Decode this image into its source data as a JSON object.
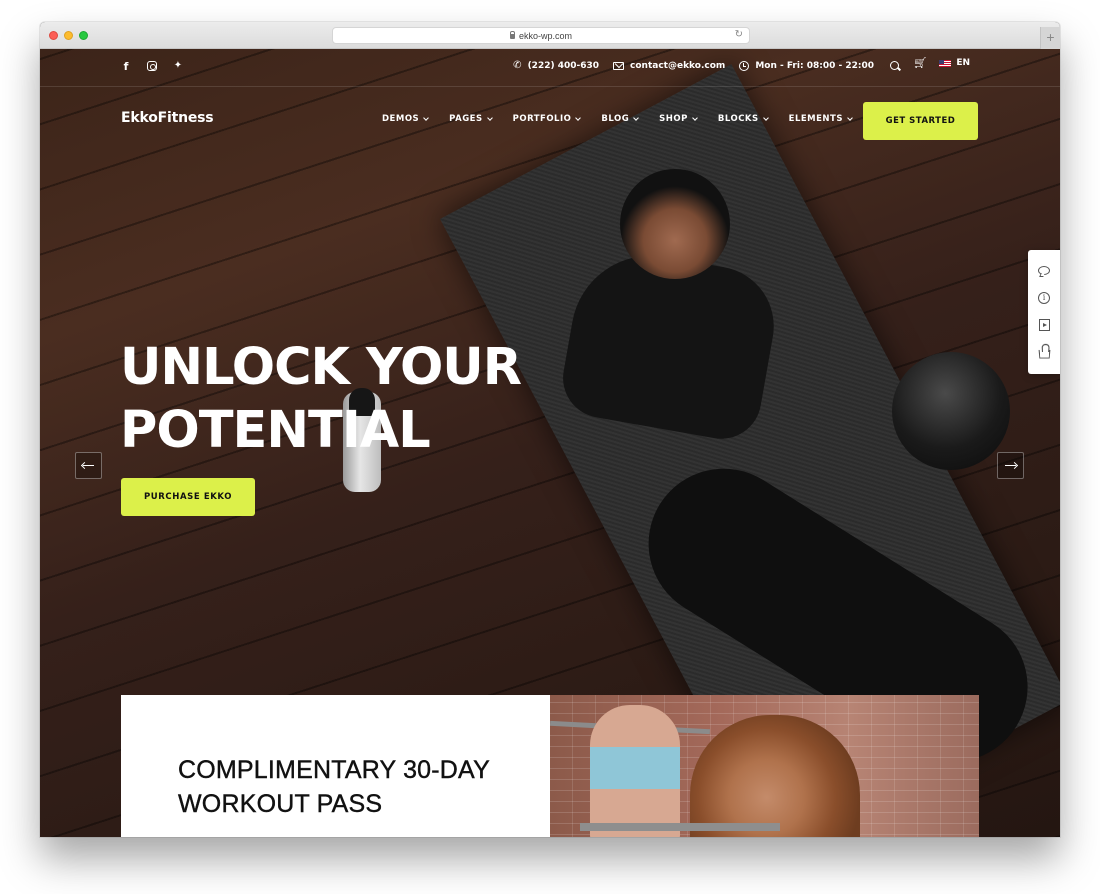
{
  "browser": {
    "url": "ekko-wp.com",
    "new_tab_symbol": "+",
    "reload_symbol": "↻"
  },
  "topbar": {
    "social": [
      {
        "name": "facebook",
        "glyph": "f"
      },
      {
        "name": "instagram",
        "glyph": ""
      },
      {
        "name": "twitter",
        "glyph": "🐦"
      }
    ],
    "phone": "(222) 400-630",
    "email": "contact@ekko.com",
    "hours": "Mon - Fri: 08:00 - 22:00",
    "phone_glyph": "✆",
    "cart_glyph": "🛒",
    "language": "EN"
  },
  "navbar": {
    "logo": "EkkoFitness",
    "menu": [
      {
        "label": "DEMOS"
      },
      {
        "label": "PAGES"
      },
      {
        "label": "PORTFOLIO"
      },
      {
        "label": "BLOG"
      },
      {
        "label": "SHOP"
      },
      {
        "label": "BLOCKS"
      },
      {
        "label": "ELEMENTS"
      }
    ],
    "cta_label": "GET STARTED"
  },
  "hero": {
    "title_line1": "UNLOCK YOUR",
    "title_line2": "POTENTIAL",
    "button_label": "PURCHASE EKKO"
  },
  "side_panel": {
    "items": [
      "chat",
      "info",
      "video",
      "shop"
    ],
    "info_glyph": "i"
  },
  "promo": {
    "title_line1": "COMPLIMENTARY 30-DAY",
    "title_line2": "WORKOUT PASS"
  },
  "colors": {
    "accent": "#dcf04a",
    "text_dark": "#111111",
    "hero_bg": "#3c2419"
  }
}
